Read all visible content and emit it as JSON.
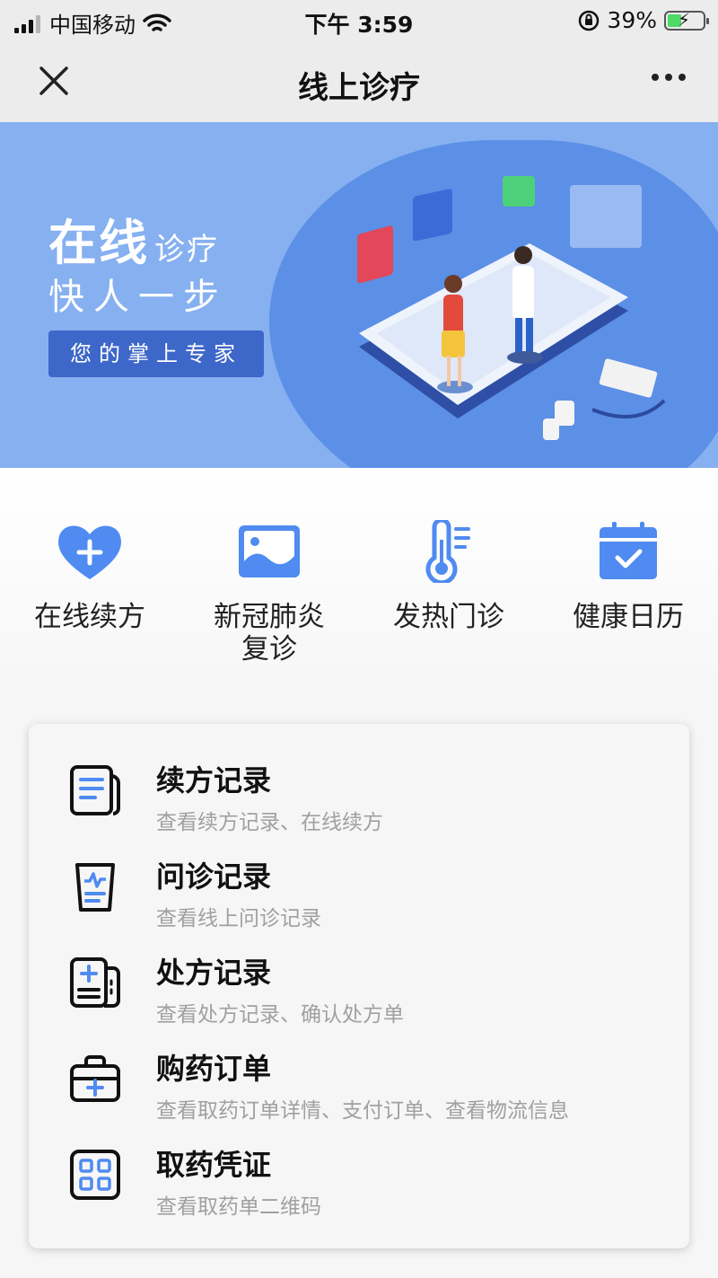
{
  "status_bar": {
    "carrier": "中国移动",
    "time": "下午 3:59",
    "battery": "39%",
    "battery_level": 0.39
  },
  "nav": {
    "title": "线上诊疗",
    "close_icon": "close-icon",
    "more_icon": "more-icon"
  },
  "banner": {
    "title_big": "在线",
    "title_small": "诊疗",
    "subtitle": "快人一步",
    "tag": "您的掌上专家"
  },
  "quick_actions": [
    {
      "label": "在线续方",
      "icon": "heart-plus-icon"
    },
    {
      "label": "新冠肺炎复诊",
      "icon": "image-icon"
    },
    {
      "label": "发热门诊",
      "icon": "thermometer-icon"
    },
    {
      "label": "健康日历",
      "icon": "calendar-check-icon"
    }
  ],
  "records": [
    {
      "title": "续方记录",
      "subtitle": "查看续方记录、在线续方",
      "icon": "document-icon"
    },
    {
      "title": "问诊记录",
      "subtitle": "查看线上问诊记录",
      "icon": "consultation-icon"
    },
    {
      "title": "处方记录",
      "subtitle": "查看处方记录、确认处方单",
      "icon": "prescription-icon"
    },
    {
      "title": "购药订单",
      "subtitle": "查看取药订单详情、支付订单、查看物流信息",
      "icon": "medical-kit-icon"
    },
    {
      "title": "取药凭证",
      "subtitle": "查看取药单二维码",
      "icon": "qr-code-icon"
    }
  ],
  "colors": {
    "accent": "#4f8bf0",
    "banner_bg": "#86b0f0",
    "banner_blob": "#5c8fe6",
    "tag_bg": "#3d67c8"
  }
}
